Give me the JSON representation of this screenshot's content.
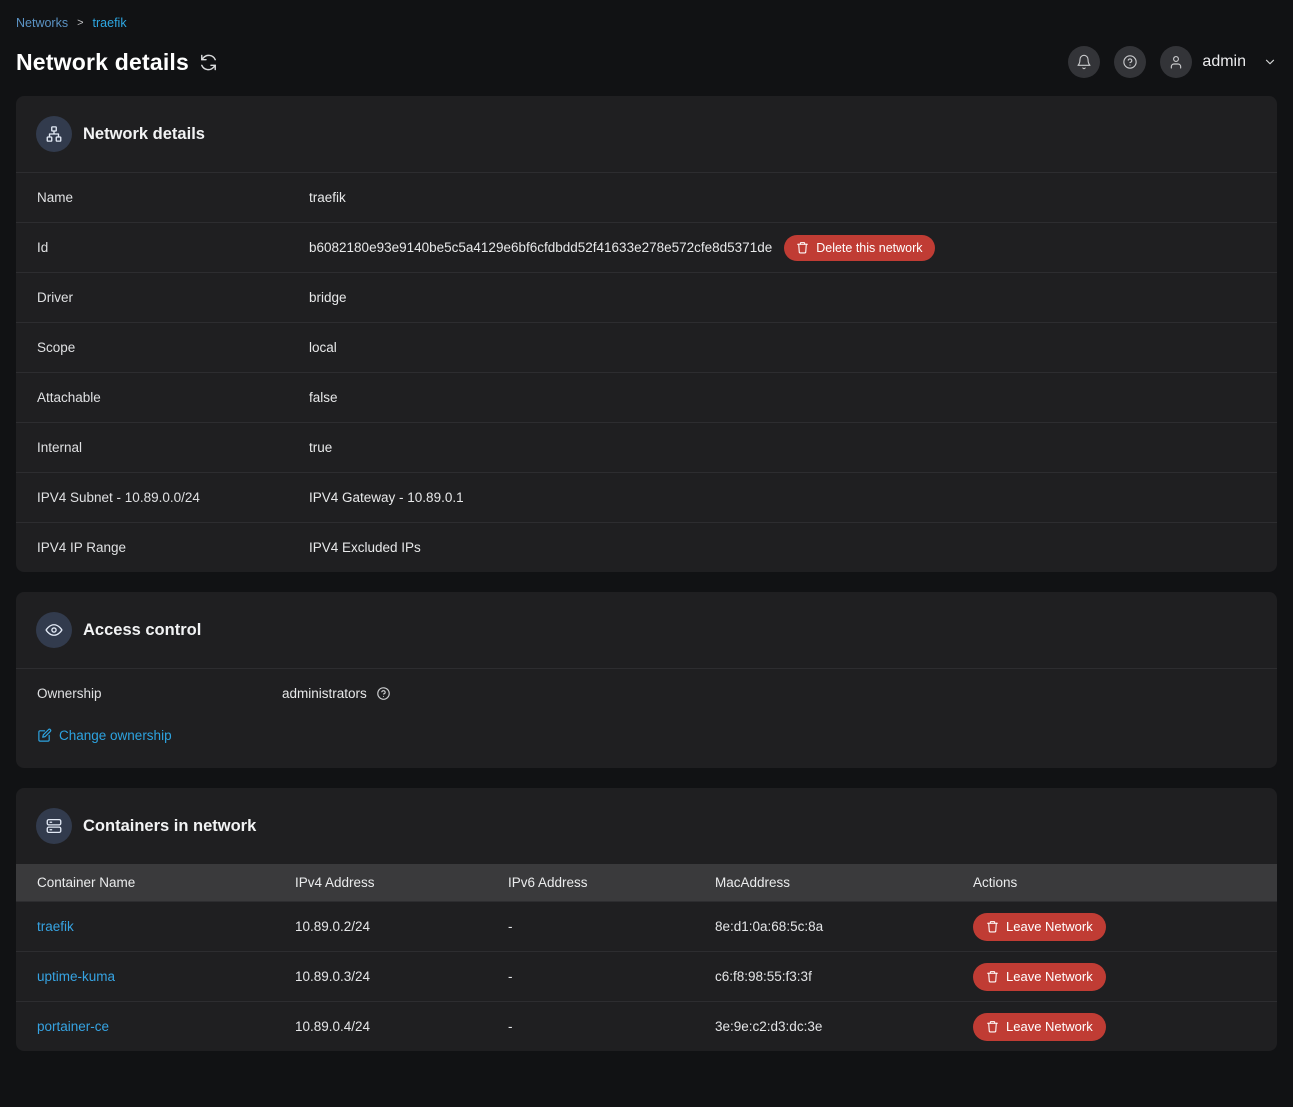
{
  "breadcrumb": {
    "items": [
      "Networks",
      "traefik"
    ],
    "separator": ">"
  },
  "page": {
    "title": "Network details"
  },
  "topbar": {
    "username": "admin"
  },
  "colors": {
    "accent_link": "#2da3e0",
    "breadcrumb_link": "#5b93c4",
    "danger": "#c03c34",
    "icon_circle": "#323b4d"
  },
  "cards": {
    "details": {
      "title": "Network details",
      "rows": [
        {
          "label": "Name",
          "value": "traefik"
        },
        {
          "label": "Id",
          "value": "b6082180e93e9140be5c5a4129e6bf6cfdbdd52f41633e278e572cfe8d5371de",
          "action": "Delete this network"
        },
        {
          "label": "Driver",
          "value": "bridge"
        },
        {
          "label": "Scope",
          "value": "local"
        },
        {
          "label": "Attachable",
          "value": "false"
        },
        {
          "label": "Internal",
          "value": "true"
        },
        {
          "label": "IPV4 Subnet - 10.89.0.0/24",
          "value": "IPV4 Gateway - 10.89.0.1"
        },
        {
          "label": "IPV4 IP Range",
          "value": "IPV4 Excluded IPs"
        }
      ]
    },
    "access": {
      "title": "Access control",
      "ownership_label": "Ownership",
      "ownership_value": "administrators",
      "change_link": "Change ownership"
    },
    "containers": {
      "title": "Containers in network",
      "columns": [
        "Container Name",
        "IPv4 Address",
        "IPv6 Address",
        "MacAddress",
        "Actions"
      ],
      "leave_label": "Leave Network",
      "rows": [
        {
          "name": "traefik",
          "ipv4": "10.89.0.2/24",
          "ipv6": "-",
          "mac": "8e:d1:0a:68:5c:8a"
        },
        {
          "name": "uptime-kuma",
          "ipv4": "10.89.0.3/24",
          "ipv6": "-",
          "mac": "c6:f8:98:55:f3:3f"
        },
        {
          "name": "portainer-ce",
          "ipv4": "10.89.0.4/24",
          "ipv6": "-",
          "mac": "3e:9e:c2:d3:dc:3e"
        }
      ]
    }
  }
}
